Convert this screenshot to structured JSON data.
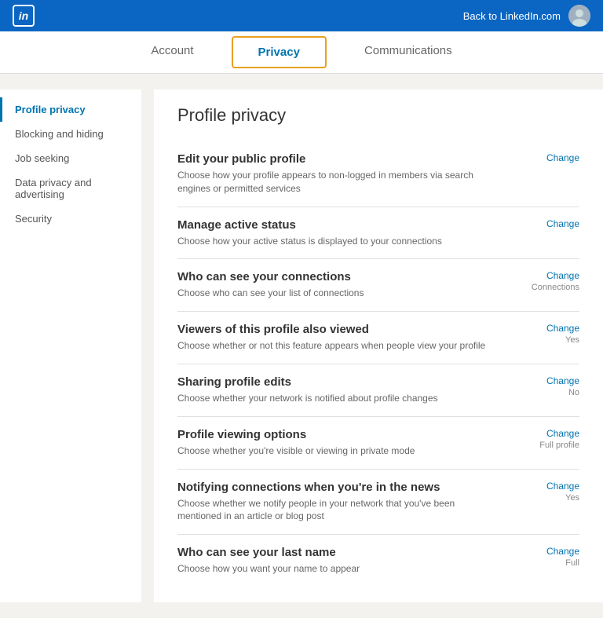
{
  "topbar": {
    "logo_text": "in",
    "back_link": "Back to LinkedIn.com"
  },
  "nav": {
    "tabs": [
      {
        "id": "account",
        "label": "Account",
        "active": false
      },
      {
        "id": "privacy",
        "label": "Privacy",
        "active": true
      },
      {
        "id": "communications",
        "label": "Communications",
        "active": false
      }
    ]
  },
  "sidebar": {
    "items": [
      {
        "id": "profile-privacy",
        "label": "Profile privacy",
        "active": true
      },
      {
        "id": "blocking-hiding",
        "label": "Blocking and hiding",
        "active": false
      },
      {
        "id": "job-seeking",
        "label": "Job seeking",
        "active": false
      },
      {
        "id": "data-privacy",
        "label": "Data privacy and advertising",
        "active": false
      },
      {
        "id": "security",
        "label": "Security",
        "active": false
      }
    ]
  },
  "content": {
    "title": "Profile privacy",
    "settings": [
      {
        "id": "public-profile",
        "title": "Edit your public profile",
        "description": "Choose how your profile appears to non-logged in members via search engines or permitted services",
        "change_label": "Change",
        "value": ""
      },
      {
        "id": "active-status",
        "title": "Manage active status",
        "description": "Choose how your active status is displayed to your connections",
        "change_label": "Change",
        "value": ""
      },
      {
        "id": "connections",
        "title": "Who can see your connections",
        "description": "Choose who can see your list of connections",
        "change_label": "Change",
        "value": "Connections"
      },
      {
        "id": "viewers-also-viewed",
        "title": "Viewers of this profile also viewed",
        "description": "Choose whether or not this feature appears when people view your profile",
        "change_label": "Change",
        "value": "Yes"
      },
      {
        "id": "sharing-edits",
        "title": "Sharing profile edits",
        "description": "Choose whether your network is notified about profile changes",
        "change_label": "Change",
        "value": "No"
      },
      {
        "id": "profile-viewing",
        "title": "Profile viewing options",
        "description": "Choose whether you're visible or viewing in private mode",
        "change_label": "Change",
        "value": "Full profile"
      },
      {
        "id": "news-notifications",
        "title": "Notifying connections when you're in the news",
        "description": "Choose whether we notify people in your network that you've been mentioned in an article or blog post",
        "change_label": "Change",
        "value": "Yes"
      },
      {
        "id": "last-name",
        "title": "Who can see your last name",
        "description": "Choose how you want your name to appear",
        "change_label": "Change",
        "value": "Full"
      }
    ]
  }
}
